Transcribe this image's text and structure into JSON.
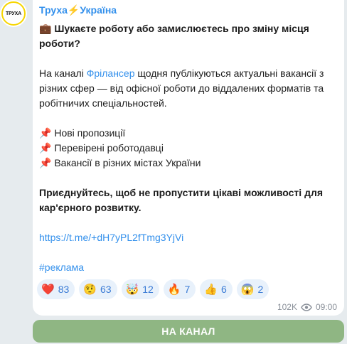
{
  "channel": {
    "name_part1": "Труха",
    "bolt": "⚡",
    "name_part2": "Україна",
    "avatar_text": "ТРУХА"
  },
  "message": {
    "headline_icon": "💼",
    "headline": "Шукаєте роботу або замислюєтесь про зміну місця роботи?",
    "para1_prefix": "На каналі ",
    "para1_link": "Фрілансер",
    "para1_suffix": " щодня публікуються актуальні вакансії з різних сфер — від офісної роботи до віддалених форматів та робітничих спеціальностей.",
    "bullets": [
      {
        "icon": "📌",
        "text": "Нові пропозиції"
      },
      {
        "icon": "📌",
        "text": "Перевірені роботодавці"
      },
      {
        "icon": "📌",
        "text": "Вакансії в різних містах України"
      }
    ],
    "cta": "Приєднуйтесь, щоб не пропустити цікаві можливості для кар'єрного розвитку.",
    "url": "https://t.me/+dH7yPL2fTmg3YjVi",
    "hashtag": "#реклама"
  },
  "reactions": [
    {
      "emoji": "❤️",
      "count": "83",
      "icon_name": "heart-icon"
    },
    {
      "emoji": "🤨",
      "count": "63",
      "icon_name": "raised-eyebrow-icon"
    },
    {
      "emoji": "🤯",
      "count": "12",
      "icon_name": "exploding-head-icon"
    },
    {
      "emoji": "🔥",
      "count": "7",
      "icon_name": "fire-icon"
    },
    {
      "emoji": "👍",
      "count": "6",
      "icon_name": "thumbs-up-icon"
    },
    {
      "emoji": "😱",
      "count": "2",
      "icon_name": "screaming-face-icon"
    }
  ],
  "meta": {
    "views": "102K",
    "time": "09:00"
  },
  "button": {
    "label": "НА КАНАЛ"
  },
  "colors": {
    "accent": "#3390ec",
    "button": "#8fb683",
    "avatar": "#f6d500"
  }
}
